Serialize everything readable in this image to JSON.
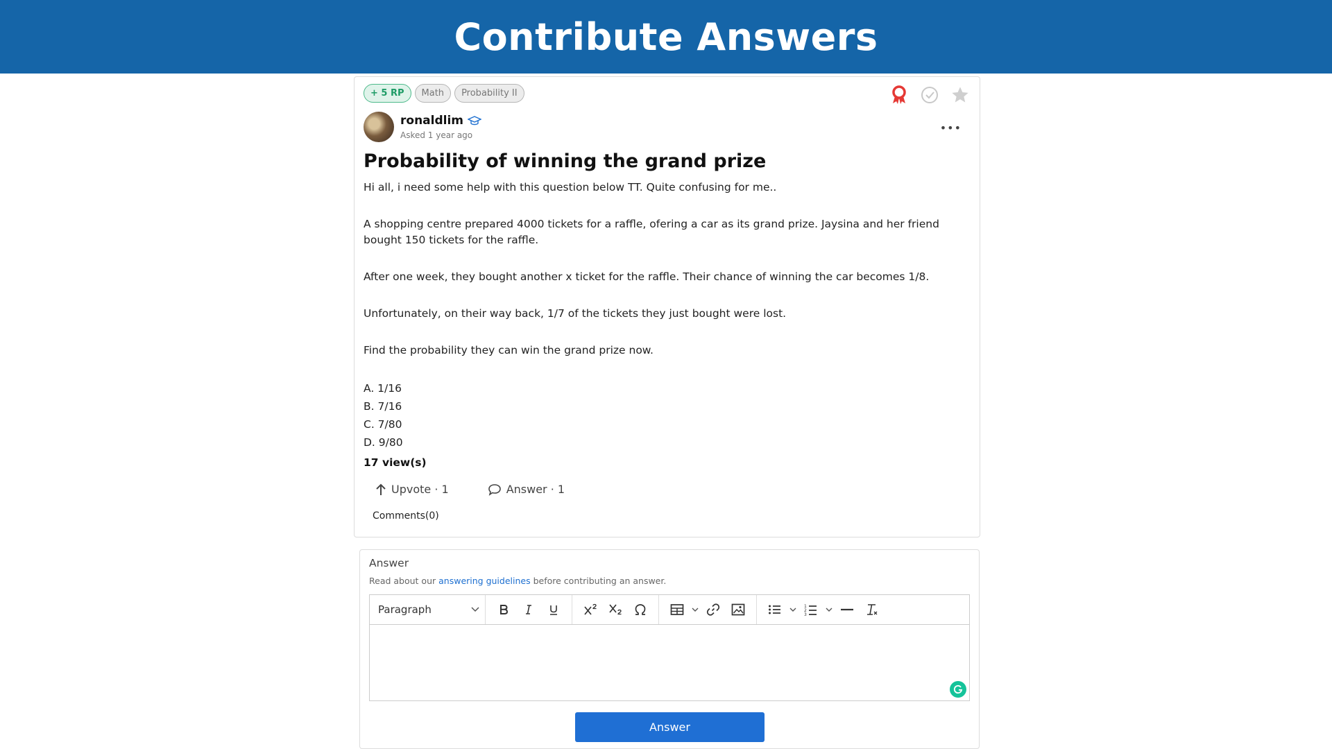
{
  "banner": {
    "title": "Contribute Answers"
  },
  "question": {
    "tags": [
      "+ 5 RP",
      "Math",
      "Probability II"
    ],
    "author": {
      "username": "ronaldlim",
      "asked": "Asked 1 year ago"
    },
    "title": "Probability of winning the grand prize",
    "intro": "Hi all, i need some help with this question below TT. Quite confusing for me..",
    "paragraphs": [
      "A shopping centre prepared 4000 tickets for a raffle, ofering a car as its grand prize. Jaysina and her friend bought 150 tickets for the raffle.",
      "After one week, they bought another x ticket for the raffle. Their chance of winning the car becomes 1/8.",
      "Unfortunately, on their way back, 1/7 of the tickets they just bought were lost.",
      "Find the probability they can win the grand prize now."
    ],
    "options": [
      "A. 1/16",
      "B. 7/16",
      "C. 7/80",
      "D. 9/80"
    ],
    "views": "17 view(s)",
    "upvote_label": "Upvote · 1",
    "answer_label": "Answer · 1",
    "comments_label": "Comments(0)",
    "icons": {
      "award": "award-ribbon-icon",
      "check": "check-circle-icon",
      "star": "star-icon"
    },
    "colors": {
      "award": "#e53935",
      "rp_green": "#1e9c66",
      "banner": "#1565a8"
    }
  },
  "answer_form": {
    "label": "Answer",
    "guide_prefix": "Read about our",
    "guide_link": "answering guidelines",
    "guide_suffix": "before contributing an answer.",
    "format_select": "Paragraph",
    "submit_label": "Answer",
    "colors": {
      "button": "#1f6fd4",
      "link": "#1d6fd0",
      "grammarly": "#15c39a"
    }
  }
}
